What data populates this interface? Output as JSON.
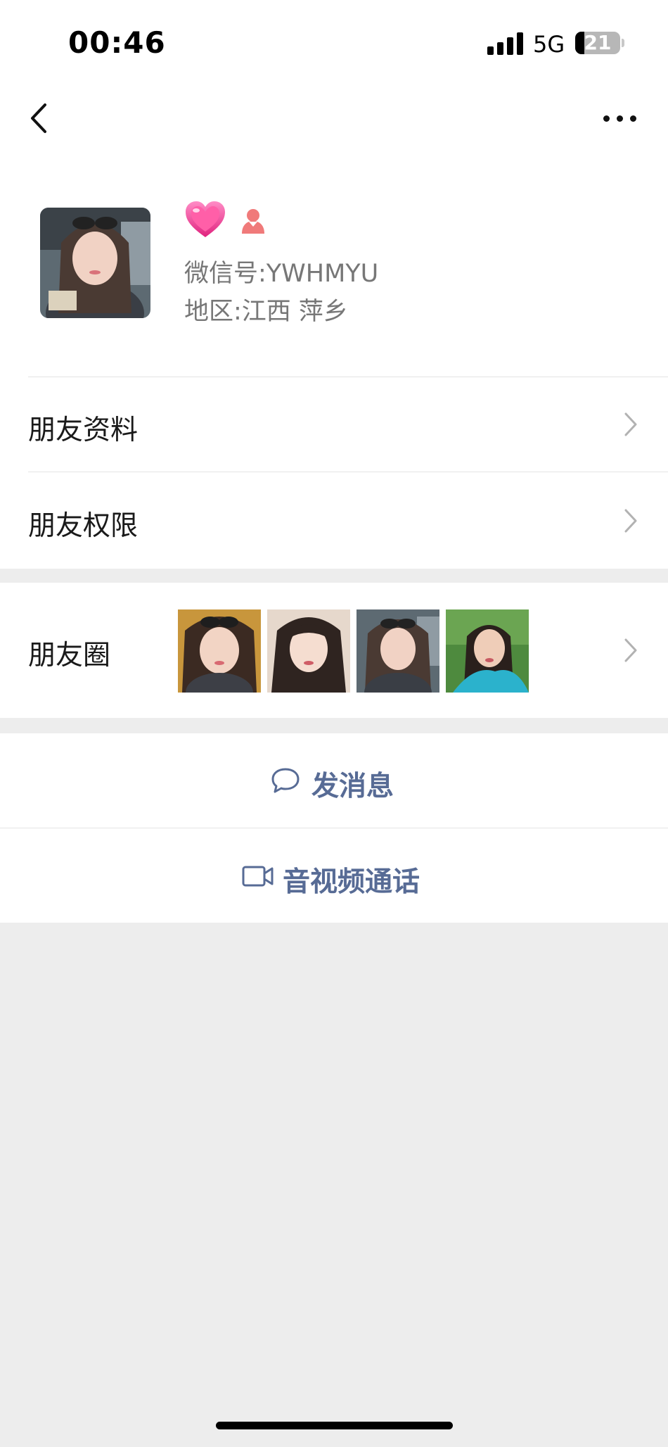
{
  "status_bar": {
    "time": "00:46",
    "network": "5G",
    "battery_level": "21",
    "signal_bars": 4
  },
  "nav": {
    "back_icon": "chevron-left-icon",
    "more_icon": "ellipsis-icon"
  },
  "profile": {
    "name_icon": "pink-heart-emoji",
    "gender_icon": "female-icon",
    "wechat_id_label": "微信号:",
    "wechat_id": "YWHMYU",
    "region_label": "地区:",
    "region": "江西 萍乡"
  },
  "menu": {
    "friend_profile": "朋友资料",
    "friend_permissions": "朋友权限",
    "moments": "朋友圈"
  },
  "actions": {
    "send_message": "发消息",
    "av_call": "音视频通话"
  },
  "colors": {
    "accent": "#576b95",
    "background": "#ededed",
    "heart": "#f0468f",
    "gender": "#f07a7a"
  }
}
